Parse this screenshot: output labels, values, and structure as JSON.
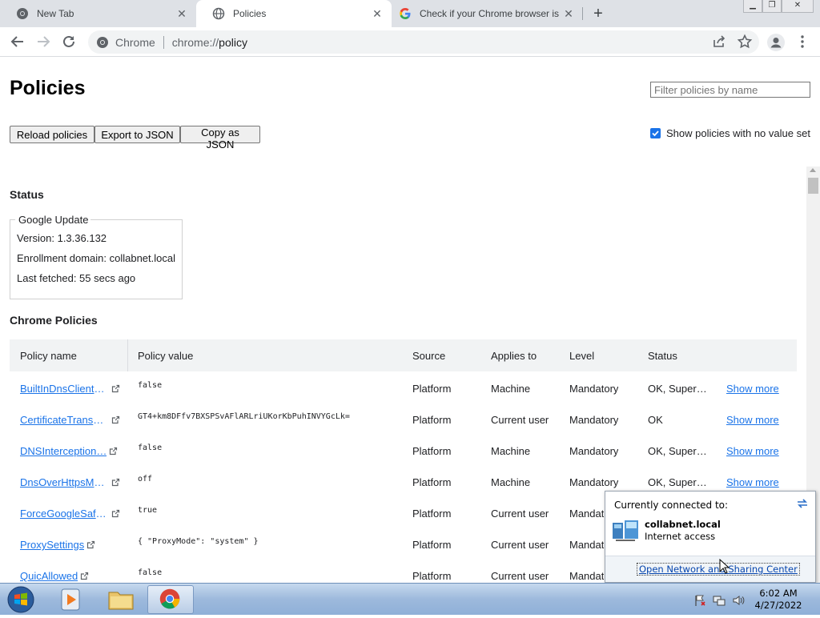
{
  "tabs": [
    {
      "title": "New Tab",
      "close": "✕"
    },
    {
      "title": "Policies",
      "close": "✕"
    },
    {
      "title": "Check if your Chrome browser is",
      "close": "✕"
    }
  ],
  "new_tab_label": "+",
  "window_controls": {
    "minimize": "▁",
    "restore": "❐",
    "close": "✕"
  },
  "omnibox": {
    "scheme_label": "Chrome",
    "url_host": "chrome://",
    "url_path": "policy"
  },
  "page": {
    "title": "Policies",
    "filter_placeholder": "Filter policies by name",
    "buttons": {
      "reload": "Reload policies",
      "export": "Export to JSON",
      "copy": "Copy as JSON"
    },
    "show_unset_label": "Show policies with no value set",
    "show_unset_checked": true
  },
  "status": {
    "heading": "Status",
    "legend": "Google Update",
    "lines": [
      "Version: 1.3.36.132",
      "Enrollment domain: collabnet.local",
      "Last fetched: 55 secs ago"
    ]
  },
  "chrome_policies": {
    "heading": "Chrome Policies",
    "columns": [
      "Policy name",
      "Policy value",
      "Source",
      "Applies to",
      "Level",
      "Status"
    ],
    "rows": [
      {
        "name": "BuiltInDnsClientE…",
        "value": "false",
        "source": "Platform",
        "applies": "Machine",
        "level": "Mandatory",
        "status": "OK, Supers…",
        "more": "Show more"
      },
      {
        "name": "CertificateTransp…",
        "value": "GT4+km8DFfv7BXSPSvAFlARLriUKorKbPuhINVYGcLk=",
        "source": "Platform",
        "applies": "Current user",
        "level": "Mandatory",
        "status": "OK",
        "more": "Show more"
      },
      {
        "name": "DNSInterception…",
        "value": "false",
        "source": "Platform",
        "applies": "Machine",
        "level": "Mandatory",
        "status": "OK, Supers…",
        "more": "Show more"
      },
      {
        "name": "DnsOverHttpsMo…",
        "value": "off",
        "source": "Platform",
        "applies": "Machine",
        "level": "Mandatory",
        "status": "OK, Supers…",
        "more": "Show more"
      },
      {
        "name": "ForceGoogleSafe…",
        "value": "true",
        "source": "Platform",
        "applies": "Current user",
        "level": "Mandat",
        "status": "",
        "more": ""
      },
      {
        "name": "ProxySettings",
        "value": "{ \"ProxyMode\": \"system\" }",
        "source": "Platform",
        "applies": "Current user",
        "level": "Mandat",
        "status": "",
        "more": ""
      },
      {
        "name": "QuicAllowed",
        "value": "false",
        "source": "Platform",
        "applies": "Current user",
        "level": "Mandat",
        "status": "",
        "more": ""
      }
    ]
  },
  "network_popup": {
    "header": "Currently connected to:",
    "network_name": "collabnet.local",
    "network_access": "Internet access",
    "link": "Open Network and Sharing Center"
  },
  "taskbar": {
    "time": "6:02 AM",
    "date": "4/27/2022"
  },
  "colors": {
    "link": "#1a73e8",
    "tab_strip": "#dee1e6",
    "table_header": "#f1f3f4",
    "taskbar": "#9db9dc"
  }
}
